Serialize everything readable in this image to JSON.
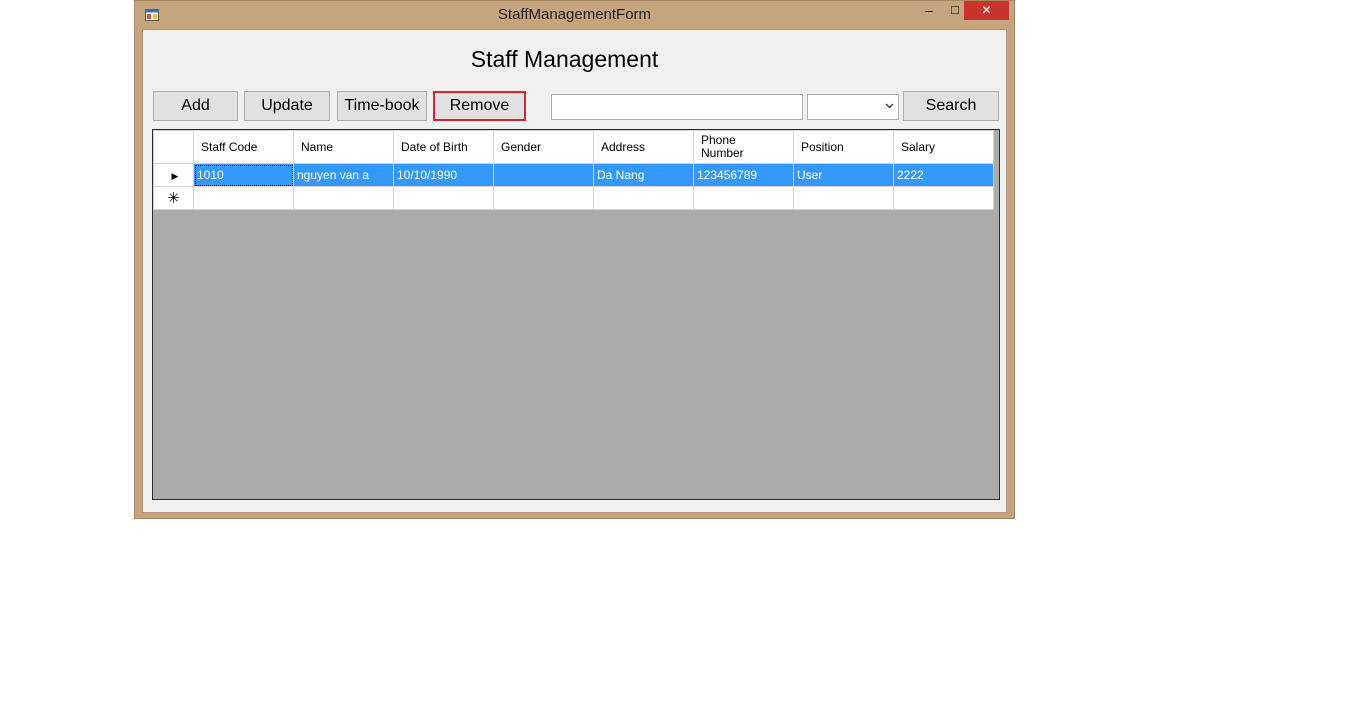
{
  "window": {
    "title": "StaffManagementForm",
    "minimize_glyph": "–",
    "maximize_glyph": "□",
    "close_glyph": "✕"
  },
  "form": {
    "heading": "Staff Management"
  },
  "toolbar": {
    "add_label": "Add",
    "update_label": "Update",
    "timebook_label": "Time-book",
    "remove_label": "Remove",
    "search_label": "Search",
    "search_value": "",
    "filter_value": ""
  },
  "grid": {
    "columns": [
      "Staff Code",
      "Name",
      "Date of Birth",
      "Gender",
      "Address",
      "Phone Number",
      "Position",
      "Salary"
    ],
    "current_row_glyph": "▶",
    "new_row_glyph": "✳",
    "rows": [
      [
        "1010",
        "nguyen van a",
        "10/10/1990",
        "",
        "Da Nang",
        "123456789",
        "User",
        "2222"
      ]
    ]
  },
  "colors": {
    "selection": "#3399ff",
    "focus_border": "#d9232e",
    "close_button": "#c7342b",
    "window_frame": "#c6a47d"
  }
}
